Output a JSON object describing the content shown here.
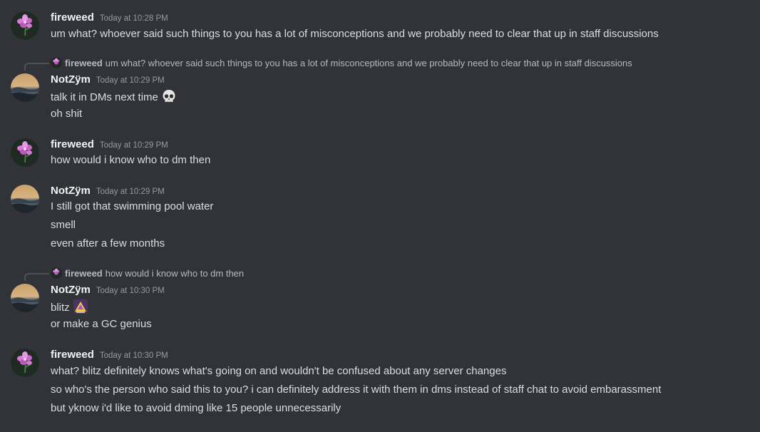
{
  "users": {
    "fireweed": "fireweed",
    "notzym": "NotZÿm"
  },
  "messages": [
    {
      "author": "fireweed",
      "timestamp": "Today at 10:28 PM",
      "lines": [
        "um what? whoever said such things to you has a lot of misconceptions and we probably need to clear that up in staff discussions"
      ]
    },
    {
      "author": "NotZÿm",
      "timestamp": "Today at 10:29 PM",
      "reply": {
        "author": "fireweed",
        "text": "um what? whoever said such things to you has a lot of misconceptions and we probably need to clear that up in staff discussions"
      },
      "lines": [
        "talk it in DMs next time",
        "oh shit"
      ],
      "emoji": "skull-emoji"
    },
    {
      "author": "fireweed",
      "timestamp": "Today at 10:29 PM",
      "lines": [
        "how would i know who to dm then"
      ]
    },
    {
      "author": "NotZÿm",
      "timestamp": "Today at 10:29 PM",
      "lines": [
        "I still got that swimming pool water",
        "smell",
        "even after a few months"
      ]
    },
    {
      "author": "NotZÿm",
      "timestamp": "Today at 10:30 PM",
      "reply": {
        "author": "fireweed",
        "text": "how would i know who to dm then"
      },
      "lines": [
        "blitz",
        "or make a GC genius"
      ],
      "emoji": "custom-emoji"
    },
    {
      "author": "fireweed",
      "timestamp": "Today at 10:30 PM",
      "lines": [
        "what? blitz definitely knows what's going on and wouldn't be confused about any server changes",
        "so who's the person who said this to you? i can definitely address it with them in dms instead of staff chat to avoid embarassment",
        "but yknow i'd like to avoid dming like 15 people unnecessarily"
      ]
    }
  ],
  "colors": {
    "background": "#313338",
    "text": "#dbdee1",
    "username": "#f2f3f5",
    "timestamp": "#949ba4",
    "reply": "#b5bac1"
  }
}
